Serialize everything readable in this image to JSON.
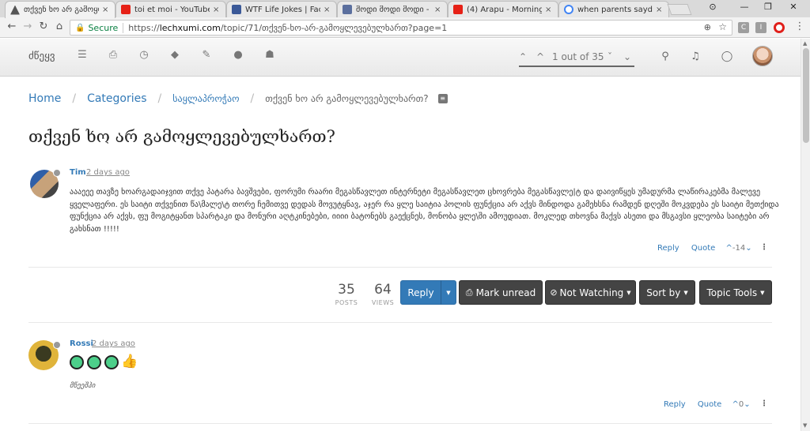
{
  "browser": {
    "tabs": [
      {
        "title": "თქვენ ხო არ გამოყლ",
        "favicon_color": "#555555",
        "active": true
      },
      {
        "title": "toi et moi - YouTube",
        "favicon_color": "#e62117",
        "active": false
      },
      {
        "title": "WTF Life Jokes | Facebo",
        "favicon_color": "#3b5998",
        "active": false
      },
      {
        "title": "მოდი მოდი მოდი -",
        "favicon_color": "#5b6f9e",
        "active": false
      },
      {
        "title": "(4) Arapu - Morning Ch",
        "favicon_color": "#e62117",
        "active": false
      },
      {
        "title": "when parents sayd you",
        "favicon_color": "#4285f4",
        "active": false
      }
    ],
    "tab_close": "×",
    "window_controls": [
      "—",
      "❐",
      "✕"
    ],
    "profile_icon": "⊙",
    "nav": {
      "back": "←",
      "forward": "→",
      "reload": "↻",
      "home": "⌂"
    },
    "address": {
      "secure_label": "Secure",
      "url_prefix": "https://",
      "url_host": "lechxumi.com",
      "url_path": "/topic/71/თქვენ-ხო-არ-გამოყლევებულხართ?page=1"
    },
    "zoom_icon": "⊕",
    "star_icon": "☆",
    "extensions": [
      {
        "name": "ext-c",
        "letter": "C",
        "color": "#9e9e9e"
      },
      {
        "name": "ext-i",
        "letter": "I",
        "color": "#9e9e9e"
      },
      {
        "name": "opera",
        "letter": "O",
        "color": "#e0201b"
      }
    ],
    "menu_icon": "⋮"
  },
  "header": {
    "brand": "ძწეყვ",
    "nav_icons": [
      {
        "name": "list-icon",
        "glyph": "☰"
      },
      {
        "name": "inbox-icon",
        "glyph": "⎙"
      },
      {
        "name": "clock-icon",
        "glyph": "◷"
      },
      {
        "name": "tags-icon",
        "glyph": "◆"
      },
      {
        "name": "pencil-icon",
        "glyph": "✎"
      },
      {
        "name": "user-icon",
        "glyph": "●"
      },
      {
        "name": "users-icon",
        "glyph": "☗"
      }
    ],
    "pagination": {
      "first": "⌃",
      "prev": "^",
      "label": "1 out of 35",
      "next": "ˇ",
      "last": "⌄"
    },
    "search_icon": "⚲",
    "bell_icon": "♫",
    "chat_icon": "◯"
  },
  "breadcrumb": {
    "home": "Home",
    "categories": "Categories",
    "category": "საყლაპროჭაო",
    "current": "თქვენ ხო არ გამოყლევებულხართ?",
    "separator": "/",
    "rss_icon": "≡"
  },
  "topic": {
    "title": "თქვენ ხო არ გამოყლევებულხართ?",
    "posts_count": "35",
    "posts_label": "POSTS",
    "views_count": "64",
    "views_label": "VIEWS"
  },
  "actions": {
    "reply": "Reply",
    "mark_unread": "Mark unread",
    "not_watching": "Not Watching",
    "sort_by": "Sort by",
    "topic_tools": "Topic Tools",
    "caret": "▼"
  },
  "posts": [
    {
      "username": "Tim",
      "timeago": "2 days ago",
      "body": "აააეეე თავზე ხოარგადაიჯვით თქვე პატარა ბავშვები, ფორუმი რაარი მეგასწავლეთ ინტერნეტი მეგასწავლეთ ცხოვრება მეგასწავლე|ტ და დაივიწყეს უმადურმა ლაწირაკებმა მალევე ყველაფერი. ეს საიტი თქვენით წა\\მალე\\ტ თორე ჩემითვე დედას მოვუტყნავ, აჯერ რა ყლე საიტია პოლის ფუნქცია არ აქვს მინდოდა გამეხსნა რამდენ დღეში მოკვდება ეს საიტი მეთქიდა ფუნქცია არ აქვს, ფუ მოგიტყანთ სპარტაკი და მონური აღტკინებები, იიიი ბატონებს გაექცნეს, მონობა ყლე\\ში ამოუდიათ. მოკლედ თხოვნა მაქვს ასეთი და მსგავსი ყლეობა საიტები არ გახსნათ !!!!!",
      "reply": "Reply",
      "quote": "Quote",
      "votes": "-14"
    },
    {
      "username": "Rossi",
      "timeago": "2 days ago",
      "signature": "მწეეშჰი",
      "reply": "Reply",
      "quote": "Quote",
      "votes": "0"
    }
  ],
  "post_menu_icon": "⋮",
  "vote_up_icon": "^",
  "vote_down_icon": "⌄",
  "thumbs_icon": "👍",
  "colors": {
    "link": "#337ab7",
    "primary": "#337ab7",
    "dark_button": "#444444"
  }
}
